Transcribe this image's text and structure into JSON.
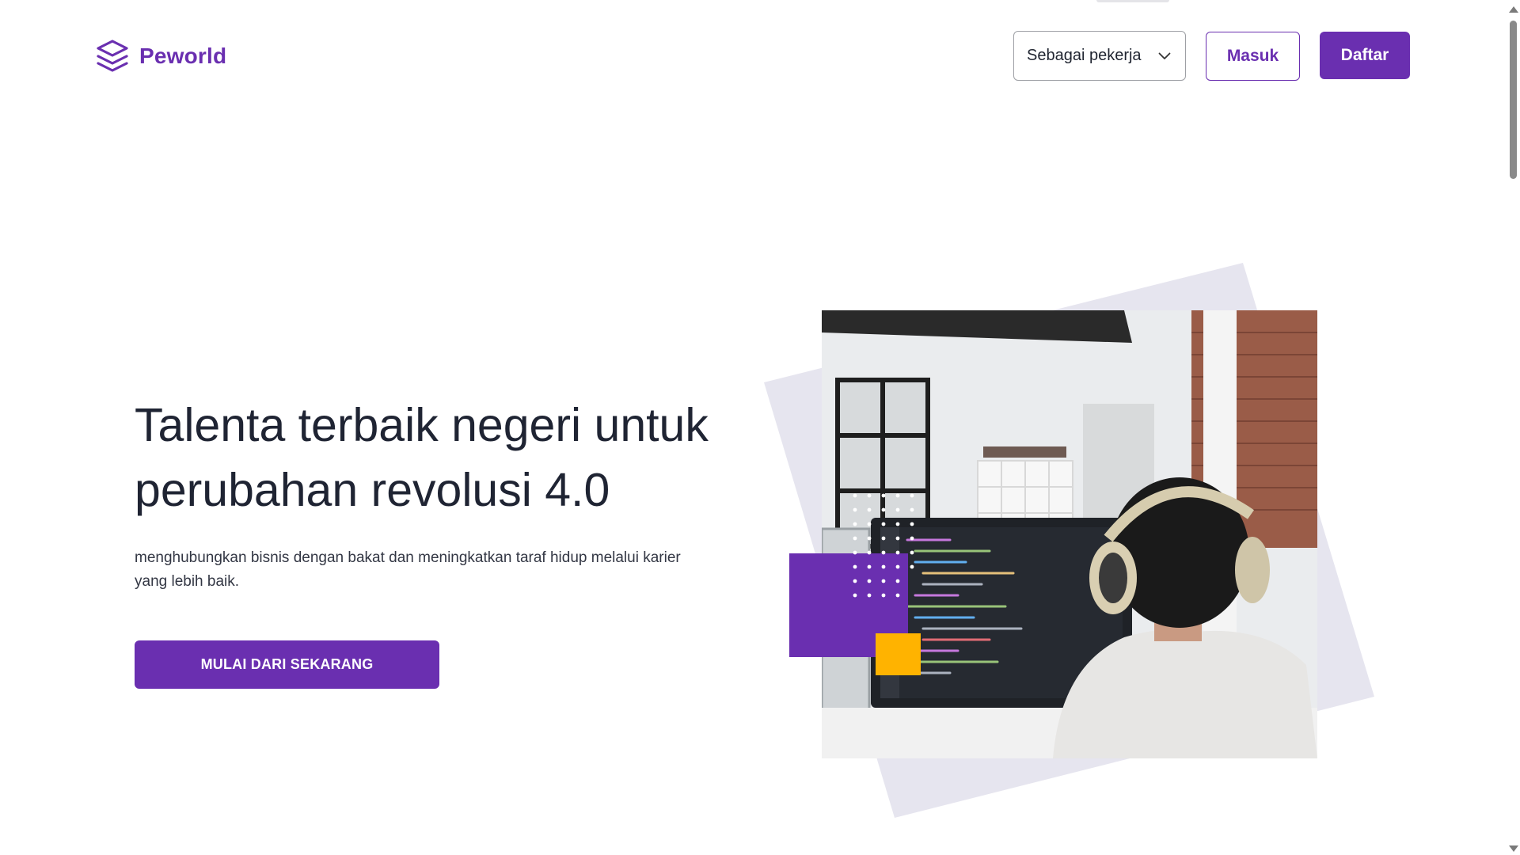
{
  "header": {
    "logo_text": "Peworld",
    "role_select": {
      "selected": "Sebagai pekerja",
      "icon": "chevron-down-icon"
    },
    "login_label": "Masuk",
    "register_label": "Daftar"
  },
  "hero": {
    "title_lines": [
      "Talenta terbaik negeri untuk",
      "perubahan revolusi 4.0"
    ],
    "description_lines": [
      "menghubungkan bisnis dengan bakat dan meningkatkan taraf hidup melalui karier",
      "yang lebih baik."
    ],
    "cta_label": "MULAI DARI SEKARANG"
  },
  "colors": {
    "brand": "#6a2fb0",
    "accent_yellow": "#ffb300",
    "backdrop": "#e6e5ef",
    "heading": "#1f2433"
  }
}
